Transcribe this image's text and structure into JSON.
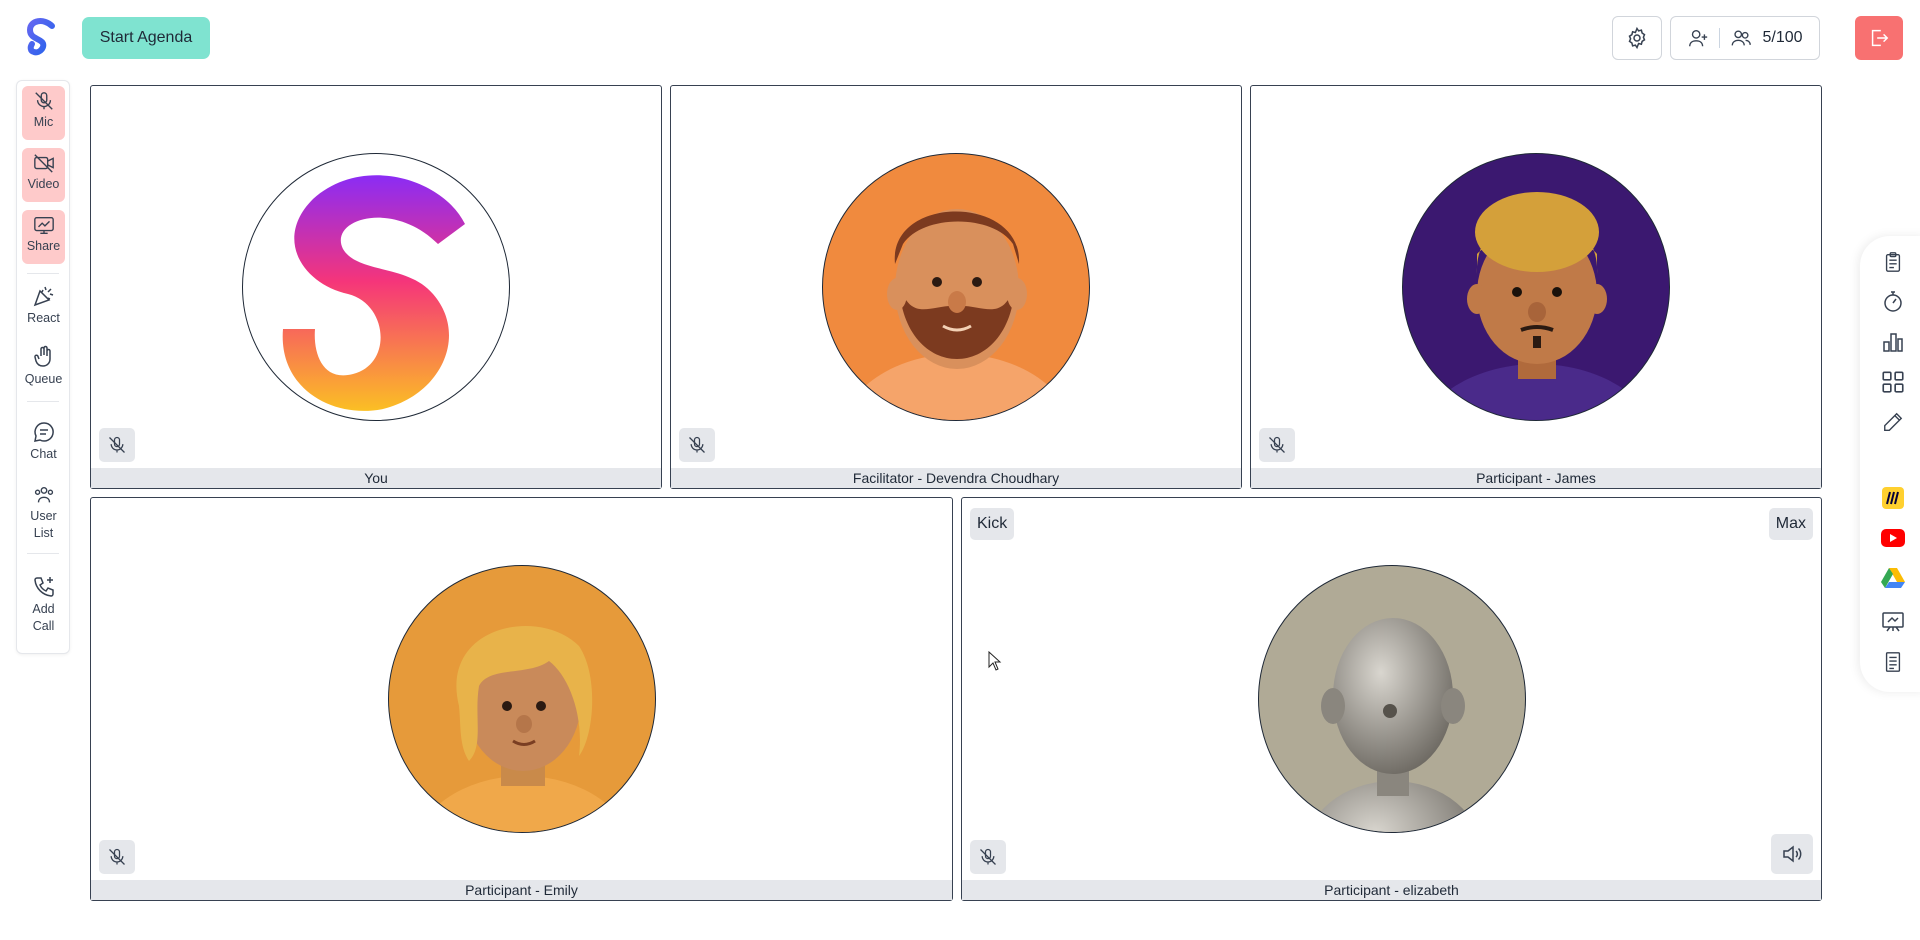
{
  "header": {
    "start_agenda_label": "Start Agenda",
    "participants_count": "5/100"
  },
  "toolbar": {
    "mic": "Mic",
    "video": "Video",
    "share": "Share",
    "react": "React",
    "queue": "Queue",
    "chat": "Chat",
    "user_list_1": "User",
    "user_list_2": "List",
    "add_call_1": "Add",
    "add_call_2": "Call"
  },
  "tiles": [
    {
      "name": "You"
    },
    {
      "name": "Facilitator - Devendra Choudhary"
    },
    {
      "name": "Participant - James"
    },
    {
      "name": "Participant - Emily"
    },
    {
      "name": "Participant - elizabeth",
      "kick_label": "Kick",
      "max_label": "Max"
    }
  ],
  "colors": {
    "accent_teal": "#7fe3d0",
    "leave_red": "#f87171",
    "active_pink": "#fecaca"
  },
  "right_tools": [
    "notes-icon",
    "timer-icon",
    "poll-icon",
    "apps-grid-icon",
    "pencil-icon",
    "miro-icon",
    "youtube-icon",
    "google-drive-icon",
    "whiteboard-icon",
    "document-icon"
  ]
}
